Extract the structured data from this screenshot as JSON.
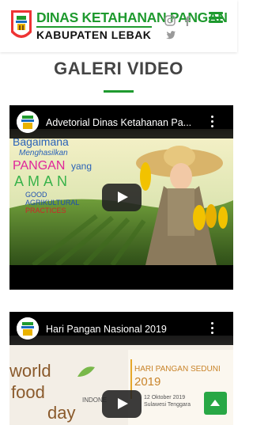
{
  "header": {
    "brand_title": "DINAS KETAHANAN PANGAN",
    "brand_subtitle": "KABUPATEN LEBAK",
    "social": [
      "instagram-icon",
      "facebook-icon",
      "twitter-icon"
    ],
    "accent_color": "#1f9a2f"
  },
  "section": {
    "title": "GALERI VIDEO"
  },
  "videos": [
    {
      "title": "Advetorial Dinas Ketahanan Pa...",
      "thumb_text": {
        "line1": "Bagaimana",
        "line2": "Menghasilkan",
        "line3a": "PANGAN",
        "line3b": "yang",
        "line4": "AMAN",
        "line5": "GOOD",
        "line6": "AGRIKULTURAL",
        "line7": "PRACTICES"
      }
    },
    {
      "title": "Hari Pangan Nasional 2019",
      "thumb_text": {
        "w1": "world",
        "w2": "food",
        "w3": "day",
        "indo": "INDONE",
        "hps1": "HARI PANGAN SEDUNI",
        "hps2": "2019",
        "date": "12 Oktober 2019",
        "place": "Sulawesi Tenggara"
      }
    }
  ]
}
